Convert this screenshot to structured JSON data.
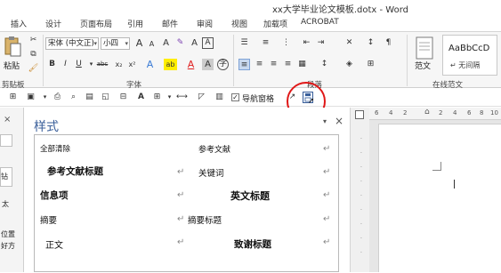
{
  "window": {
    "title": "xx大学毕业论文模板.dotx - Word"
  },
  "tabs": [
    "插入",
    "设计",
    "页面布局",
    "引用",
    "邮件",
    "审阅",
    "视图",
    "加载项",
    "ACROBAT"
  ],
  "ribbon": {
    "clipboard": {
      "paste_label": "粘贴",
      "group_label": "剪贴板"
    },
    "font": {
      "font_name": "宋体 (中文正)",
      "font_size": "小四",
      "grow_label": "A",
      "shrink_label": "A",
      "clear_label": "A",
      "phonetic_label": "A",
      "border_label": "A",
      "bold": "B",
      "italic": "I",
      "underline": "U",
      "strike": "abc",
      "sub": "x₂",
      "sup": "x²",
      "effects": "A",
      "highlight": "ab",
      "color": "A",
      "shade": "A",
      "enclose": "字",
      "group_label": "字体"
    },
    "paragraph": {
      "group_label": "段落"
    },
    "styles": {
      "gallery_sample": "AaBbCcD",
      "gallery_name": "↵ 无间隔",
      "fanwen_label": "范文",
      "group_label": "在线范文"
    }
  },
  "qat": {
    "nav_pane_label": "导航窗格",
    "nav_checked": true
  },
  "left_strip": {
    "items": [
      "钻",
      "太",
      "位置",
      "好方"
    ]
  },
  "styles_pane": {
    "title": "样式",
    "left": [
      {
        "label": "全部清除"
      },
      {
        "label": "参考文献标题"
      },
      {
        "label": "信息项"
      },
      {
        "label": "摘要"
      },
      {
        "label": "正文"
      }
    ],
    "right": [
      {
        "label": "参考文献"
      },
      {
        "label": "关键词"
      },
      {
        "label": "英文标题"
      },
      {
        "label": "摘要标题"
      },
      {
        "label": "致谢标题"
      }
    ]
  },
  "ruler": {
    "ticks": [
      "6",
      "4",
      "2",
      "",
      "2",
      "4",
      "6",
      "8",
      "10"
    ]
  },
  "colors": {
    "accent_red": "#e01818",
    "title_blue": "#3a5f9a",
    "font_red": "#e02020",
    "highlight_yellow": "#ffee00"
  }
}
